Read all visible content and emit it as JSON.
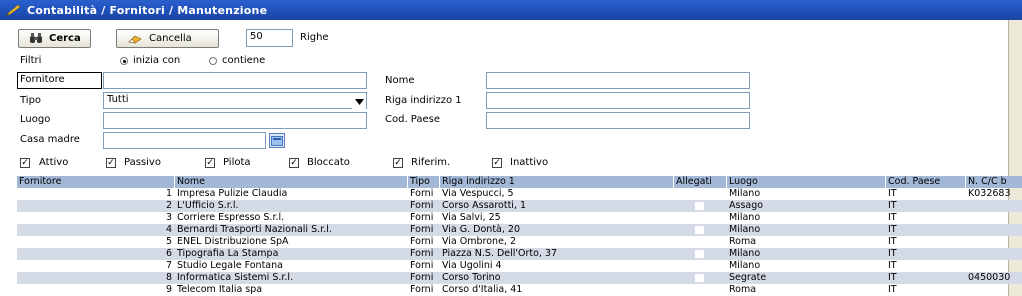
{
  "window": {
    "title": "Contabilità / Fornitori / Manutenzione"
  },
  "toolbar": {
    "search_label": "Cerca",
    "cancel_label": "Cancella",
    "rows_value": "50",
    "rows_label": "Righe"
  },
  "filters": {
    "label": "Filtri",
    "option_starts": "inizia con",
    "option_contains": "contiene",
    "selected": "inizia con"
  },
  "form": {
    "supplier_label": "Fornitore",
    "supplier_value": "",
    "type_label": "Tipo",
    "type_value": "Tutti",
    "place_label": "Luogo",
    "place_value": "",
    "parent_label": "Casa madre",
    "parent_value": "",
    "name_label": "Nome",
    "name_value": "",
    "address_label": "Riga indirizzo 1",
    "address_value": "",
    "country_label": "Cod. Paese",
    "country_value": ""
  },
  "checkboxes": [
    {
      "label": "Attivo",
      "checked": true
    },
    {
      "label": "Passivo",
      "checked": true
    },
    {
      "label": "Pilota",
      "checked": true
    },
    {
      "label": "Bloccato",
      "checked": true
    },
    {
      "label": "Riferim.",
      "checked": true
    },
    {
      "label": "Inattivo",
      "checked": true
    }
  ],
  "grid": {
    "columns": [
      "Fornitore",
      "Nome",
      "Tipo",
      "Riga indirizzo 1",
      "Allegati",
      "Luogo",
      "Cod. Paese",
      "N. C/C b"
    ],
    "rows": [
      {
        "num": "1",
        "nome": "Impresa Pulizie Claudia",
        "tipo": "Forni",
        "indirizzo": "Via Vespucci, 5",
        "allegati": "",
        "luogo": "Milano",
        "paese": "IT",
        "cc": "K032683"
      },
      {
        "num": "2",
        "nome": "L'Ufficio S.r.l.",
        "tipo": "Forni",
        "indirizzo": "Corso Assarotti, 1",
        "allegati": "",
        "luogo": "Assago",
        "paese": "IT",
        "cc": ""
      },
      {
        "num": "3",
        "nome": "Corriere Espresso S.r.l.",
        "tipo": "Forni",
        "indirizzo": "Via Salvi, 25",
        "allegati": "",
        "luogo": "Milano",
        "paese": "IT",
        "cc": ""
      },
      {
        "num": "4",
        "nome": "Bernardi Trasporti Nazionali S.r.l.",
        "tipo": "Forni",
        "indirizzo": "Via G. Dontà, 20",
        "allegati": "",
        "luogo": "Milano",
        "paese": "IT",
        "cc": ""
      },
      {
        "num": "5",
        "nome": "ENEL Distribuzione SpA",
        "tipo": "Forni",
        "indirizzo": "Via Ombrone, 2",
        "allegati": "",
        "luogo": "Roma",
        "paese": "IT",
        "cc": ""
      },
      {
        "num": "6",
        "nome": "Tipografia La Stampa",
        "tipo": "Forni",
        "indirizzo": "Piazza N.S. Dell'Orto, 37",
        "allegati": "",
        "luogo": "Milano",
        "paese": "IT",
        "cc": ""
      },
      {
        "num": "7",
        "nome": "Studio Legale Fontana",
        "tipo": "Forni",
        "indirizzo": "Via Ugolini 4",
        "allegati": "",
        "luogo": "Milano",
        "paese": "IT",
        "cc": ""
      },
      {
        "num": "8",
        "nome": "Informatica Sistemi S.r.l.",
        "tipo": "Forni",
        "indirizzo": "Corso Torino",
        "allegati": "",
        "luogo": "Segrate",
        "paese": "IT",
        "cc": "0450030"
      },
      {
        "num": "9",
        "nome": "Telecom Italia spa",
        "tipo": "Forni",
        "indirizzo": "Corso d'Italia, 41",
        "allegati": "",
        "luogo": "Roma",
        "paese": "IT",
        "cc": ""
      }
    ]
  }
}
